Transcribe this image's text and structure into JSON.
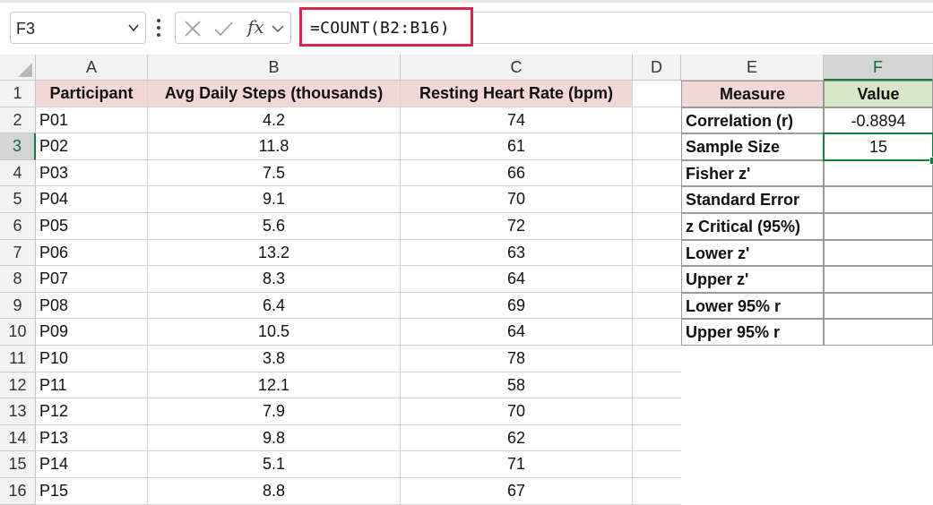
{
  "formula_bar": {
    "name_box": "F3",
    "fx_label": "fx",
    "formula": "=COUNT(B2:B16)"
  },
  "columns": [
    "A",
    "B",
    "C",
    "D",
    "E",
    "F"
  ],
  "rows": [
    "1",
    "2",
    "3",
    "4",
    "5",
    "6",
    "7",
    "8",
    "9",
    "10",
    "11",
    "12",
    "13",
    "14",
    "15",
    "16"
  ],
  "selected_cell": "F3",
  "table": {
    "headers": [
      "Participant",
      "Avg Daily Steps (thousands)",
      "Resting Heart Rate (bpm)"
    ],
    "rows": [
      [
        "P01",
        "4.2",
        "74"
      ],
      [
        "P02",
        "11.8",
        "61"
      ],
      [
        "P03",
        "7.5",
        "66"
      ],
      [
        "P04",
        "9.1",
        "70"
      ],
      [
        "P05",
        "5.6",
        "72"
      ],
      [
        "P06",
        "13.2",
        "63"
      ],
      [
        "P07",
        "8.3",
        "64"
      ],
      [
        "P08",
        "6.4",
        "69"
      ],
      [
        "P09",
        "10.5",
        "64"
      ],
      [
        "P10",
        "3.8",
        "78"
      ],
      [
        "P11",
        "12.1",
        "58"
      ],
      [
        "P12",
        "7.9",
        "70"
      ],
      [
        "P13",
        "9.8",
        "62"
      ],
      [
        "P14",
        "5.1",
        "71"
      ],
      [
        "P15",
        "8.8",
        "67"
      ]
    ]
  },
  "stats": {
    "headers": [
      "Measure",
      "Value"
    ],
    "rows": [
      [
        "Correlation (r)",
        "-0.8894"
      ],
      [
        "Sample Size",
        "15"
      ],
      [
        "Fisher z'",
        ""
      ],
      [
        "Standard Error",
        ""
      ],
      [
        "z Critical (95%)",
        ""
      ],
      [
        "Lower z'",
        ""
      ],
      [
        "Upper z'",
        ""
      ],
      [
        "Lower 95% r",
        ""
      ],
      [
        "Upper 95% r",
        ""
      ]
    ]
  },
  "colors": {
    "header_pink": "#f2d7d6",
    "header_green": "#d8e8c6",
    "selection_green": "#107c41",
    "formula_highlight": "#d6284d"
  },
  "icons": [
    "cancel-icon",
    "enter-icon",
    "function-icon",
    "chevron-down-icon",
    "more-options-icon"
  ]
}
